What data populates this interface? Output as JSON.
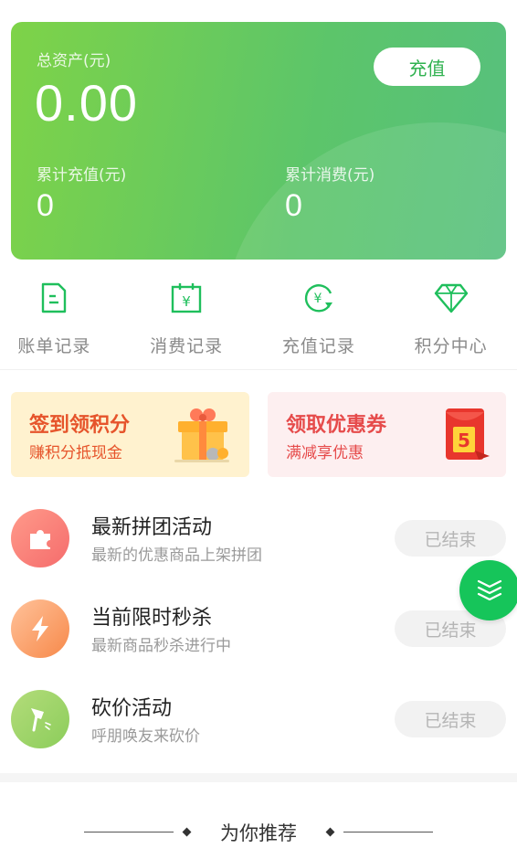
{
  "assets": {
    "total_label": "总资产(元)",
    "total_value": "0.00",
    "recharge_button": "充值",
    "cumulative_recharge_label": "累计充值(元)",
    "cumulative_recharge_value": "0",
    "cumulative_spend_label": "累计消费(元)",
    "cumulative_spend_value": "0"
  },
  "shortcuts": [
    {
      "label": "账单记录",
      "icon": "bill-document-icon"
    },
    {
      "label": "消费记录",
      "icon": "calendar-yen-icon"
    },
    {
      "label": "充值记录",
      "icon": "recharge-cycle-icon"
    },
    {
      "label": "积分中心",
      "icon": "diamond-icon"
    }
  ],
  "promos": {
    "sign_in": {
      "title": "签到领积分",
      "subtitle": "赚积分抵现金",
      "icon": "gift-box-icon"
    },
    "coupon": {
      "title": "领取优惠券",
      "subtitle": "满减享优惠",
      "icon": "red-envelope-icon",
      "badge": "5"
    }
  },
  "activities": [
    {
      "title": "最新拼团活动",
      "subtitle": "最新的优惠商品上架拼团",
      "status": "已结束",
      "icon": "puzzle-icon"
    },
    {
      "title": "当前限时秒杀",
      "subtitle": "最新商品秒杀进行中",
      "status": "已结束",
      "icon": "lightning-icon"
    },
    {
      "title": "砍价活动",
      "subtitle": "呼朋唤友来砍价",
      "status": "已结束",
      "icon": "axe-icon"
    }
  ],
  "recommend": {
    "title": "为你推荐"
  },
  "colors": {
    "primary_green": "#16c55a",
    "card_gradient_start": "#7ed348",
    "card_gradient_end": "#57c07e",
    "sign_in_bg": "#fff2cf",
    "coupon_bg": "#fdeff0"
  }
}
